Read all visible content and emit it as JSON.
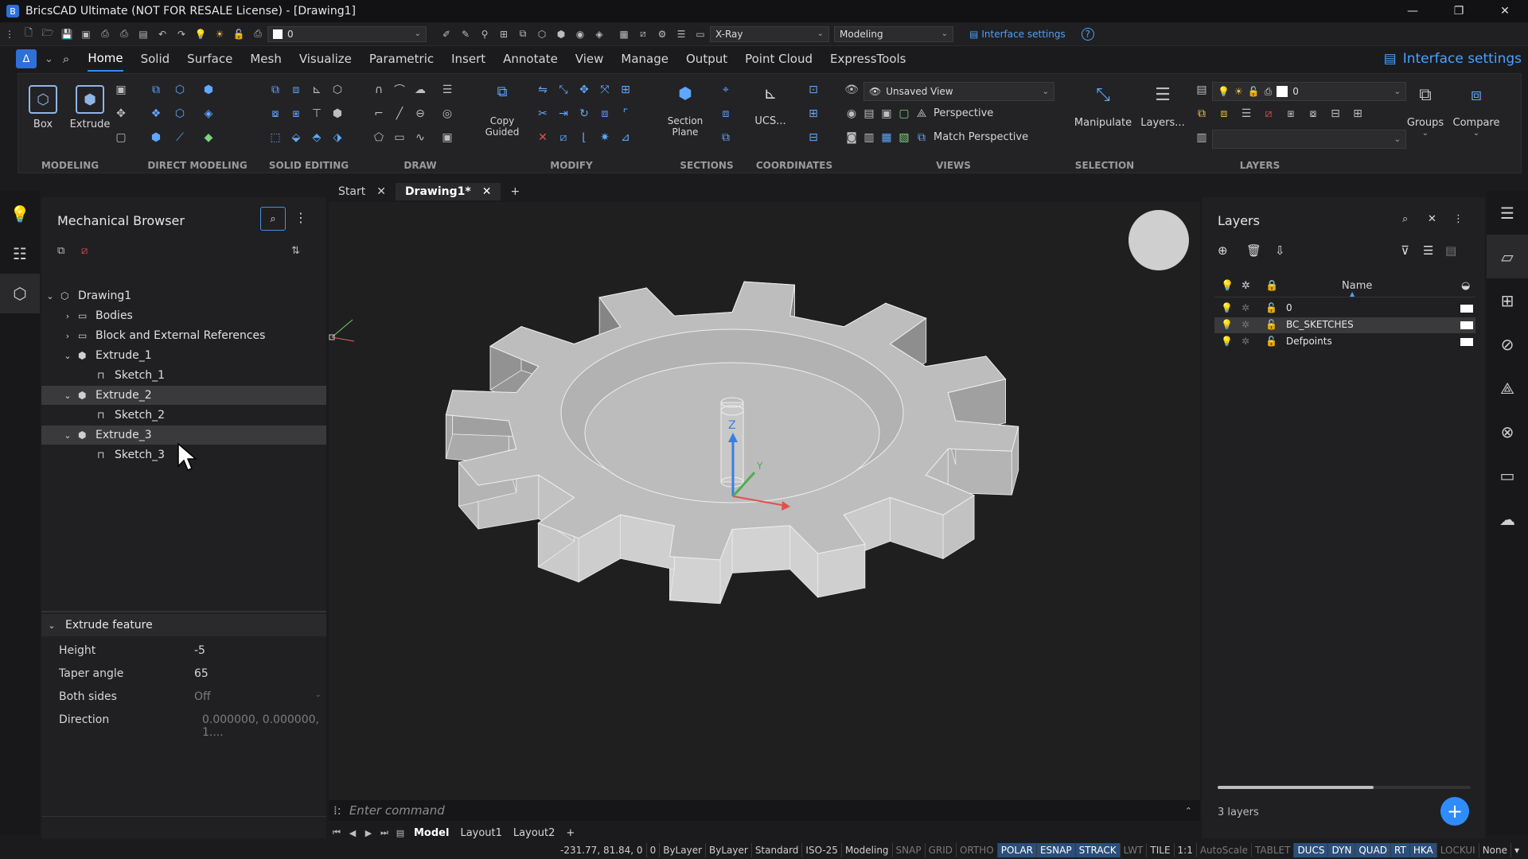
{
  "window": {
    "title": "BricsCAD Ultimate (NOT FOR RESALE License) - [Drawing1]",
    "minimize": "—",
    "restore": "❐",
    "close": "✕"
  },
  "qat": {
    "layer_value": "0",
    "visual_style": "X-Ray",
    "workspace": "Modeling",
    "interface_settings": "Interface settings",
    "help": "?"
  },
  "menu": {
    "items": [
      "Home",
      "Solid",
      "Surface",
      "Mesh",
      "Visualize",
      "Parametric",
      "Insert",
      "Annotate",
      "View",
      "Manage",
      "Output",
      "Point Cloud",
      "ExpressTools"
    ],
    "active": "Home",
    "interface_settings": "Interface settings"
  },
  "ribbon": {
    "groups": [
      "MODELING",
      "DIRECT MODELING",
      "SOLID EDITING",
      "DRAW",
      "MODIFY",
      "SECTIONS",
      "COORDINATES",
      "VIEWS",
      "SELECTION",
      "LAYERS"
    ],
    "buttons": {
      "box": "Box",
      "extrude": "Extrude",
      "copy_guided": "Copy Guided",
      "section_plane": "Section Plane",
      "ucs": "UCS...",
      "manipulate": "Manipulate",
      "layers": "Layers...",
      "groups": "Groups",
      "compare": "Compare"
    },
    "views": {
      "view_name": "Unsaved View",
      "perspective": "Perspective",
      "match_perspective": "Match Perspective"
    },
    "layers_dd": "0"
  },
  "doc_tabs": {
    "start": "Start",
    "drawing": "Drawing1*",
    "add": "+"
  },
  "mechanical_browser": {
    "title": "Mechanical Browser",
    "tree": [
      {
        "label": "Drawing1",
        "level": 0,
        "expanded": true,
        "selected": false
      },
      {
        "label": "Bodies",
        "level": 1,
        "expanded": false,
        "selected": false
      },
      {
        "label": "Block and External References",
        "level": 1,
        "expanded": false,
        "selected": false
      },
      {
        "label": "Extrude_1",
        "level": 1,
        "expanded": true,
        "selected": false
      },
      {
        "label": "Sketch_1",
        "level": 2,
        "expanded": null,
        "selected": false
      },
      {
        "label": "Extrude_2",
        "level": 1,
        "expanded": true,
        "selected": true
      },
      {
        "label": "Sketch_2",
        "level": 2,
        "expanded": null,
        "selected": false
      },
      {
        "label": "Extrude_3",
        "level": 1,
        "expanded": true,
        "selected": true
      },
      {
        "label": "Sketch_3",
        "level": 2,
        "expanded": null,
        "selected": false
      }
    ],
    "properties": {
      "header": "Extrude feature",
      "rows": [
        {
          "key": "Height",
          "value": "-5",
          "dim": false
        },
        {
          "key": "Taper angle",
          "value": "65",
          "dim": false
        },
        {
          "key": "Both sides",
          "value": "Off",
          "dim": true
        },
        {
          "key": "Direction",
          "value": "0.000000, 0.000000, 1....",
          "dim": true
        }
      ]
    }
  },
  "command": {
    "placeholder": "Enter command"
  },
  "layout_tabs": [
    "Model",
    "Layout1",
    "Layout2",
    "+"
  ],
  "status": {
    "coords": "-231.77, 81.84, 0",
    "item0": "0",
    "items": [
      {
        "t": "ByLayer",
        "s": ""
      },
      {
        "t": "ByLayer",
        "s": ""
      },
      {
        "t": "Standard",
        "s": ""
      },
      {
        "t": "ISO-25",
        "s": ""
      },
      {
        "t": "Modeling",
        "s": ""
      },
      {
        "t": "SNAP",
        "s": "off"
      },
      {
        "t": "GRID",
        "s": "off"
      },
      {
        "t": "ORTHO",
        "s": "off"
      },
      {
        "t": "POLAR",
        "s": "on"
      },
      {
        "t": "ESNAP",
        "s": "on"
      },
      {
        "t": "STRACK",
        "s": "on"
      },
      {
        "t": "LWT",
        "s": "off"
      },
      {
        "t": "TILE",
        "s": ""
      },
      {
        "t": "1:1",
        "s": ""
      },
      {
        "t": "AutoScale",
        "s": "off"
      },
      {
        "t": "TABLET",
        "s": "off"
      },
      {
        "t": "DUCS",
        "s": "on"
      },
      {
        "t": "DYN",
        "s": "on"
      },
      {
        "t": "QUAD",
        "s": "on"
      },
      {
        "t": "RT",
        "s": "on"
      },
      {
        "t": "HKA",
        "s": "on"
      },
      {
        "t": "LOCKUI",
        "s": "off"
      },
      {
        "t": "None",
        "s": ""
      }
    ]
  },
  "layers_panel": {
    "title": "Layers",
    "column_name": "Name",
    "rows": [
      {
        "name": "0",
        "selected": false
      },
      {
        "name": "BC_SKETCHES",
        "selected": true
      },
      {
        "name": "Defpoints",
        "selected": false
      }
    ],
    "count": "3 layers"
  },
  "viewport_axes": {
    "z": "Z",
    "y": "Y"
  },
  "colors": {
    "accent": "#2f8cff",
    "bg": "#1b1b1d",
    "model": "#c4c4c4"
  }
}
